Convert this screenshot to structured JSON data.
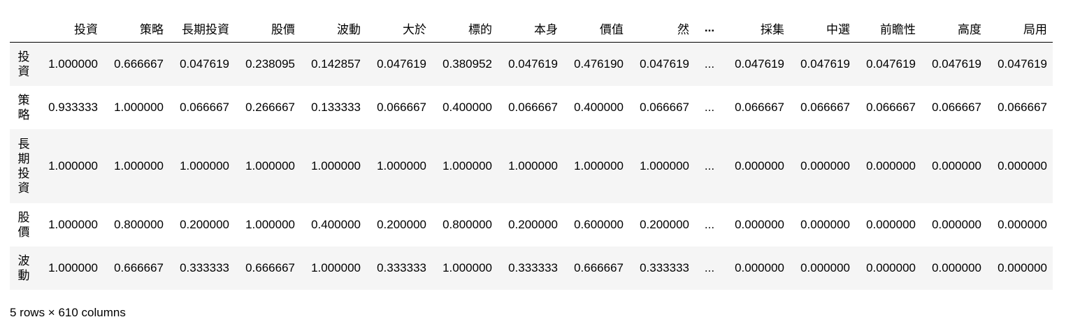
{
  "table": {
    "columns": [
      "投資",
      "策略",
      "長期投資",
      "股價",
      "波動",
      "大於",
      "標的",
      "本身",
      "價值",
      "然",
      "...",
      "採集",
      "中選",
      "前瞻性",
      "高度",
      "局用"
    ],
    "rows": [
      {
        "index": "投資",
        "index_chars": [
          "投",
          "資"
        ],
        "values": [
          "1.000000",
          "0.666667",
          "0.047619",
          "0.238095",
          "0.142857",
          "0.047619",
          "0.380952",
          "0.047619",
          "0.476190",
          "0.047619",
          "...",
          "0.047619",
          "0.047619",
          "0.047619",
          "0.047619",
          "0.047619"
        ]
      },
      {
        "index": "策略",
        "index_chars": [
          "策",
          "略"
        ],
        "values": [
          "0.933333",
          "1.000000",
          "0.066667",
          "0.266667",
          "0.133333",
          "0.066667",
          "0.400000",
          "0.066667",
          "0.400000",
          "0.066667",
          "...",
          "0.066667",
          "0.066667",
          "0.066667",
          "0.066667",
          "0.066667"
        ]
      },
      {
        "index": "長期投資",
        "index_chars": [
          "長",
          "期",
          "投",
          "資"
        ],
        "values": [
          "1.000000",
          "1.000000",
          "1.000000",
          "1.000000",
          "1.000000",
          "1.000000",
          "1.000000",
          "1.000000",
          "1.000000",
          "1.000000",
          "...",
          "0.000000",
          "0.000000",
          "0.000000",
          "0.000000",
          "0.000000"
        ]
      },
      {
        "index": "股價",
        "index_chars": [
          "股",
          "價"
        ],
        "values": [
          "1.000000",
          "0.800000",
          "0.200000",
          "1.000000",
          "0.400000",
          "0.200000",
          "0.800000",
          "0.200000",
          "0.600000",
          "0.200000",
          "...",
          "0.000000",
          "0.000000",
          "0.000000",
          "0.000000",
          "0.000000"
        ]
      },
      {
        "index": "波動",
        "index_chars": [
          "波",
          "動"
        ],
        "values": [
          "1.000000",
          "0.666667",
          "0.333333",
          "0.666667",
          "1.000000",
          "0.333333",
          "1.000000",
          "0.333333",
          "0.666667",
          "0.333333",
          "...",
          "0.000000",
          "0.000000",
          "0.000000",
          "0.000000",
          "0.000000"
        ]
      }
    ]
  },
  "shape_text": "5 rows × 610 columns",
  "colors": {
    "stripe": "#f5f5f5",
    "header_rule": "#000000",
    "text": "#000000"
  }
}
